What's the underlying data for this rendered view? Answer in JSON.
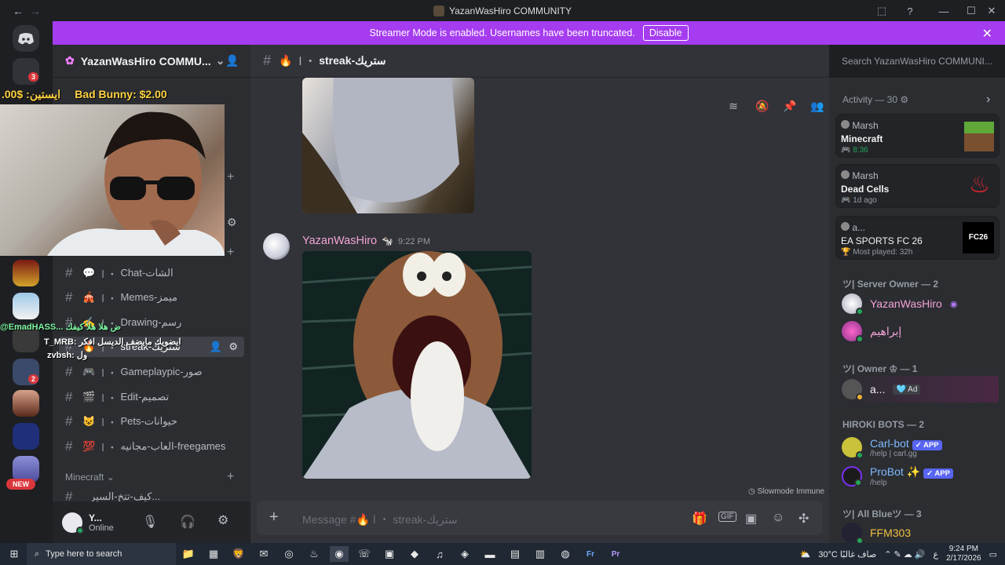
{
  "window": {
    "title": "YazanWasHiro COMMUNITY"
  },
  "banner": {
    "text": "Streamer Mode is enabled. Usernames have been truncated.",
    "disable": "Disable"
  },
  "guilds": {
    "mention_badge": "3",
    "voice_badge": "2",
    "new_label": "NEW"
  },
  "server": {
    "name": "YazanWasHiro COMMU..."
  },
  "donation": {
    "left": ".00$ :ايستين",
    "right": "Bad Bunny: $2.00"
  },
  "channels": [
    {
      "emoji": "💬",
      "name": "Chat-الشات"
    },
    {
      "emoji": "🎪",
      "name": "Memes-ميمز"
    },
    {
      "emoji": "✍️",
      "name": "Drawing-رسم"
    },
    {
      "emoji": "🔥",
      "name": "streak-ستريك"
    },
    {
      "emoji": "🎮",
      "name": "Gameplaypic-صور"
    },
    {
      "emoji": "🎬",
      "name": "Edit-تصميم"
    },
    {
      "emoji": "😺",
      "name": "Pets-حيوانات"
    },
    {
      "emoji": "💯",
      "name": "العاب-مجانيه-freegames"
    }
  ],
  "category": {
    "name": "Minecraft",
    "next_channel": "كيف-تتخ-السير..."
  },
  "overlay_chat": {
    "line1": "@EmadHASS... ض هلا هلا كيفك",
    "line2": "T_MRB: ايضويك مايضف الديسل افكر",
    "line3": "zvbsh: ول"
  },
  "user": {
    "name": "Y...",
    "status": "Online"
  },
  "channel_header": {
    "emoji": "🔥",
    "name": "streak-ستريك"
  },
  "search": {
    "placeholder": "Search YazanWasHiro COMMUNI..."
  },
  "message": {
    "author": "YazanWasHiro",
    "time": "9:22 PM"
  },
  "slowmode": "Slowmode Immune",
  "composer": {
    "placeholder": "Message #🔥 ا ・ streak-ستريك"
  },
  "activity": {
    "header": "Activity — 30",
    "items": [
      {
        "user": "Marsh",
        "game": "Minecraft",
        "meta": "8:36"
      },
      {
        "user": "Marsh",
        "game": "Dead Cells",
        "meta": "1d ago"
      },
      {
        "user": "a...",
        "game": "EA SPORTS FC 26",
        "meta": "Most played: 32h"
      }
    ]
  },
  "members": {
    "server_owner_header": "ツ| Server Owner — 2",
    "owner_header": "ツ| Owner ♔ — 1",
    "bots_header": "HIROKI BOTS — 2",
    "allblue_header": "ツ| All Blueツ — 3",
    "list": [
      {
        "name": "YazanWasHiro"
      },
      {
        "name": "إبراهيم"
      },
      {
        "name": "a...",
        "tag": "Ad"
      },
      {
        "name": "Carl-bot",
        "sub": "/help | carl.gg",
        "badge": "APP"
      },
      {
        "name": "ProBot",
        "sub": "/help",
        "badge": "APP"
      },
      {
        "name": "FFM303"
      }
    ]
  },
  "taskbar": {
    "search": "Type here to search",
    "weather": "30°C صاف غالبًا",
    "time": "9:24 PM",
    "date": "2/17/2026",
    "lang": "ع"
  },
  "colors": {
    "banner": "#a53cf0",
    "online": "#23a55a",
    "blurple": "#5865f2",
    "author": "#f3a3d6"
  }
}
